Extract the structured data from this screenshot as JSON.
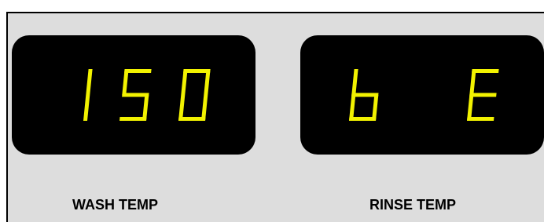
{
  "panel": {
    "segment_color": "#f2f200",
    "background_color": "#dddddd",
    "displays": [
      {
        "id": "wash",
        "digits": [
          "1",
          "5",
          "0"
        ],
        "label": "WASH TEMP"
      },
      {
        "id": "rinse",
        "digits": [
          "b",
          " ",
          "E"
        ],
        "label": "RINSE TEMP"
      }
    ]
  }
}
